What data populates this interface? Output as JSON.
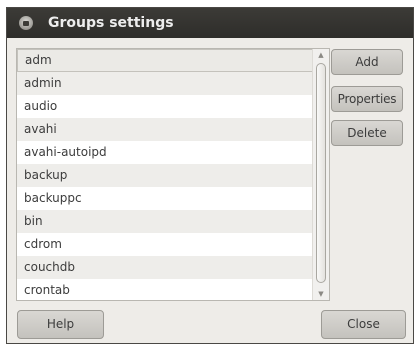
{
  "window": {
    "title": "Groups settings"
  },
  "groups": {
    "items": [
      "adm",
      "admin",
      "audio",
      "avahi",
      "avahi-autoipd",
      "backup",
      "backuppc",
      "bin",
      "cdrom",
      "couchdb",
      "crontab"
    ],
    "selected": "adm"
  },
  "actions": {
    "add_label": "Add",
    "properties_label": "Properties",
    "delete_label": "Delete"
  },
  "footer": {
    "help_label": "Help",
    "close_label": "Close"
  },
  "scrollbar": {
    "up_arrow": "▲",
    "down_arrow": "▼"
  },
  "icons": {
    "window_close": "close-icon"
  }
}
